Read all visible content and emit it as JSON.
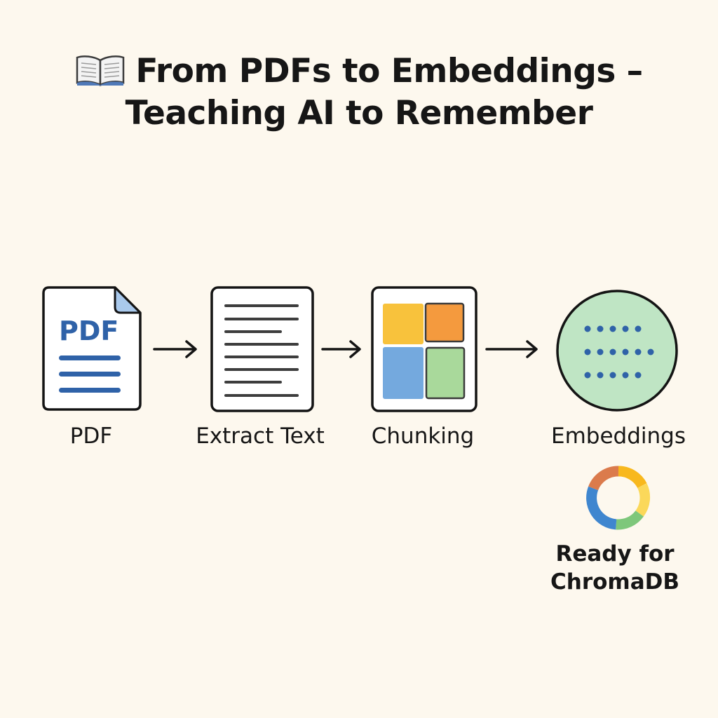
{
  "title": {
    "icon": "open-book-icon",
    "line1": "From PDFs to Embeddings –",
    "line2": "Teaching AI to Remember"
  },
  "steps": [
    {
      "id": "pdf",
      "icon": "pdf-document-icon",
      "icon_text": "PDF",
      "label": "PDF"
    },
    {
      "id": "extract",
      "icon": "text-document-icon",
      "label": "Extract Text"
    },
    {
      "id": "chunking",
      "icon": "chunk-grid-icon",
      "label": "Chunking"
    },
    {
      "id": "embeddings",
      "icon": "vector-dots-icon",
      "label": "Embeddings"
    }
  ],
  "result": {
    "icon": "chromadb-logo-icon",
    "line1": "Ready for",
    "line2": "ChromaDB"
  },
  "colors": {
    "background": "#fdf8ee",
    "pdf_blue": "#2f62a8",
    "chunk_yellow": "#f8c23c",
    "chunk_orange": "#f49a3e",
    "chunk_blue": "#74a9de",
    "chunk_green": "#a9d99b",
    "embedding_fill": "#bfe5c4"
  }
}
